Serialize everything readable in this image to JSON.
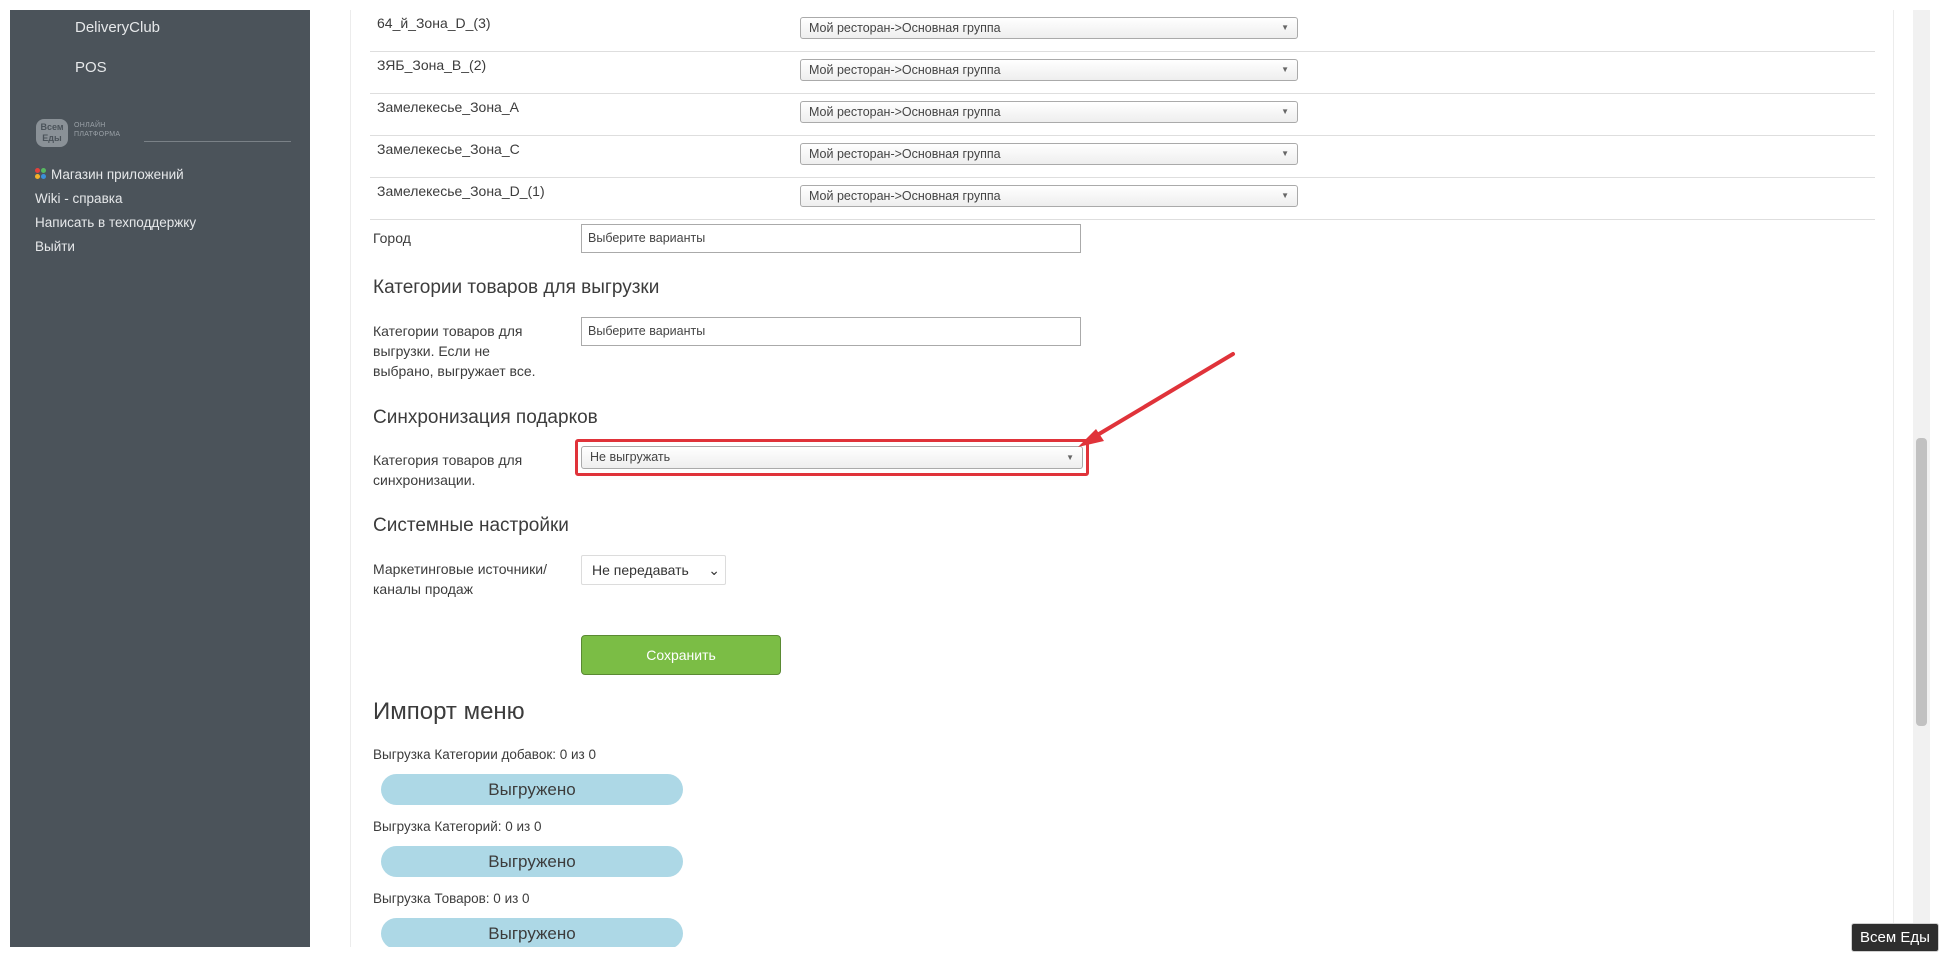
{
  "sidebar": {
    "sub_items": [
      "DeliveryClub",
      "POS"
    ],
    "brand_badge": "Всем Еды",
    "brand_tagline": "ОНЛАЙН ПЛАТФОРМА",
    "links": {
      "app_store": "Магазин приложений",
      "wiki": "Wiki - справка",
      "support": "Написать в техподдержку",
      "logout": "Выйти"
    },
    "dots_icon_colors": [
      "#e2413b",
      "#57b960",
      "#f3b22a",
      "#3b8fd9"
    ]
  },
  "zones": [
    {
      "name": "64_й_Зона_D_(3)",
      "value": "Мой ресторан->Основная группа"
    },
    {
      "name": "ЗЯБ_Зона_В_(2)",
      "value": "Мой ресторан->Основная группа"
    },
    {
      "name": "Замелекесье_Зона_А",
      "value": "Мой ресторан->Основная группа"
    },
    {
      "name": "Замелекесье_Зона_С",
      "value": "Мой ресторан->Основная группа"
    },
    {
      "name": "Замелекесье_Зона_D_(1)",
      "value": "Мой ресторан->Основная группа"
    }
  ],
  "city": {
    "label": "Город",
    "placeholder": "Выберите варианты"
  },
  "categories_section": {
    "heading": "Категории товаров для выгрузки",
    "label": "Категории товаров для выгрузки. Если не выбрано, выгружает все.",
    "placeholder": "Выберите варианты"
  },
  "gifts_section": {
    "heading": "Синхронизация подарков",
    "label": "Категория товаров для синхронизации.",
    "value": "Не выгружать",
    "highlight_color": "#e0333a"
  },
  "system_section": {
    "heading": "Системные настройки",
    "label": "Маркетинговые источники/ каналы продаж",
    "value": "Не передавать"
  },
  "save_button": {
    "label": "Сохранить",
    "color": "#7bbd45"
  },
  "import_menu": {
    "heading": "Импорт меню",
    "items": [
      {
        "label": "Выгрузка Категории добавок: 0 из 0",
        "status": "Выгружено"
      },
      {
        "label": "Выгрузка Категорий: 0 из 0",
        "status": "Выгружено"
      },
      {
        "label": "Выгрузка Товаров: 0 из 0",
        "status": "Выгружено"
      }
    ]
  },
  "tooltip": "Всем Еды"
}
